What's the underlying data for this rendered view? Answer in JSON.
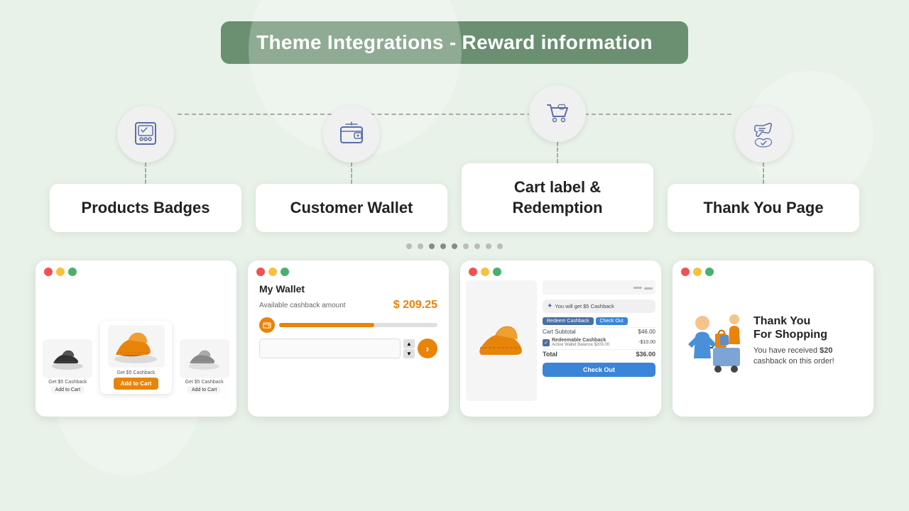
{
  "page": {
    "title": "Theme Integrations - Reward information",
    "background_color": "#d9ead9"
  },
  "features": [
    {
      "id": "products-badges",
      "label": "Products Badges",
      "icon": "badge-icon"
    },
    {
      "id": "customer-wallet",
      "label": "Customer Wallet",
      "icon": "wallet-icon"
    },
    {
      "id": "cart-label",
      "label": "Cart label &\nRedemption",
      "icon": "cart-icon"
    },
    {
      "id": "thank-you",
      "label": "Thank You Page",
      "icon": "thank-icon"
    }
  ],
  "previews": {
    "wallet": {
      "title": "My Wallet",
      "label": "Available cashback amount",
      "amount": "$ 209.25"
    },
    "cart": {
      "cashback_msg": "You will get $5 Cashback",
      "redeem_btn": "Redeem Cashback",
      "checkout_btn": "Check Out",
      "subtotal_label": "Cart Subtotal",
      "subtotal_value": "$46.00",
      "redemption_label": "Redeemable Cashback",
      "redemption_sub": "Active Wallet Balance $209.00",
      "redemption_value": "-$10.00",
      "total_label": "Total",
      "total_value": "$36.00",
      "checkout_big_btn": "Check Out"
    },
    "thankyou": {
      "title": "Thank You\nFor Shopping",
      "description": "You have received $20 cashback on this order!"
    },
    "badge": {
      "cashback_label": "Get $5 Cashback",
      "add_btn": "Add to Cart"
    }
  },
  "dots": [
    1,
    2,
    3,
    4,
    5,
    6,
    7,
    8,
    9
  ]
}
